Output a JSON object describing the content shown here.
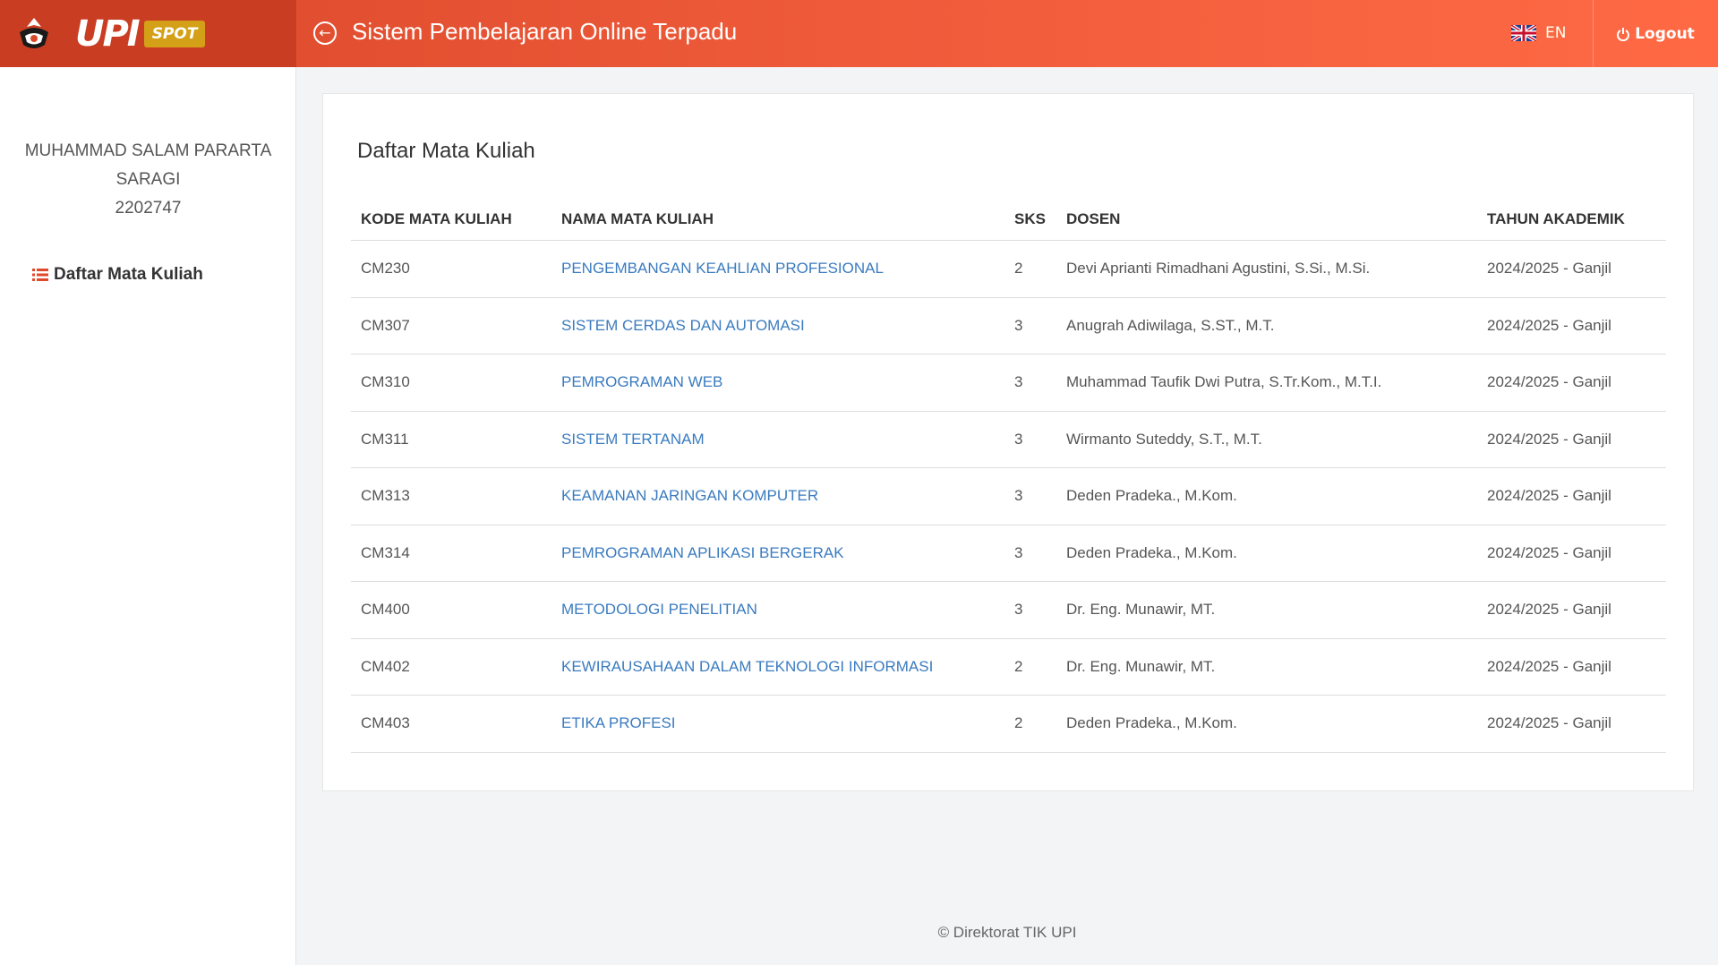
{
  "header": {
    "brand_text": "UPI",
    "brand_badge": "SPOT",
    "back_icon": "arrow-left-circle-icon",
    "title": "Sistem Pembelajaran Online Terpadu",
    "language_label": "EN",
    "logout_label": "Logout",
    "logout_icon": "power-icon",
    "colors": {
      "primary": "#ef5b3a",
      "brand_dark": "#c93e22",
      "badge": "#d4a017",
      "link": "#3a7bbf"
    }
  },
  "sidebar": {
    "user_name_line1": "MUHAMMAD SALAM PARARTA",
    "user_name_line2": "SARAGI",
    "user_id": "2202747",
    "nav_label": "Daftar Mata Kuliah",
    "nav_icon": "list-icon"
  },
  "main": {
    "title": "Daftar Mata Kuliah",
    "columns": [
      "KODE MATA KULIAH",
      "NAMA MATA KULIAH",
      "SKS",
      "DOSEN",
      "TAHUN AKADEMIK"
    ],
    "rows": [
      {
        "kode": "CM230",
        "nama": "PENGEMBANGAN KEAHLIAN PROFESIONAL",
        "sks": "2",
        "dosen": "Devi Aprianti Rimadhani Agustini, S.Si., M.Si.",
        "tahun": "2024/2025 - Ganjil"
      },
      {
        "kode": "CM307",
        "nama": "SISTEM CERDAS DAN AUTOMASI",
        "sks": "3",
        "dosen": "Anugrah Adiwilaga, S.ST., M.T.",
        "tahun": "2024/2025 - Ganjil"
      },
      {
        "kode": "CM310",
        "nama": "PEMROGRAMAN WEB",
        "sks": "3",
        "dosen": "Muhammad Taufik Dwi Putra, S.Tr.Kom., M.T.I.",
        "tahun": "2024/2025 - Ganjil"
      },
      {
        "kode": "CM311",
        "nama": "SISTEM TERTANAM",
        "sks": "3",
        "dosen": "Wirmanto Suteddy, S.T., M.T.",
        "tahun": "2024/2025 - Ganjil"
      },
      {
        "kode": "CM313",
        "nama": "KEAMANAN JARINGAN KOMPUTER",
        "sks": "3",
        "dosen": "Deden Pradeka., M.Kom.",
        "tahun": "2024/2025 - Ganjil"
      },
      {
        "kode": "CM314",
        "nama": "PEMROGRAMAN APLIKASI BERGERAK",
        "sks": "3",
        "dosen": "Deden Pradeka., M.Kom.",
        "tahun": "2024/2025 - Ganjil"
      },
      {
        "kode": "CM400",
        "nama": "METODOLOGI PENELITIAN",
        "sks": "3",
        "dosen": "Dr. Eng. Munawir, MT.",
        "tahun": "2024/2025 - Ganjil"
      },
      {
        "kode": "CM402",
        "nama": "KEWIRAUSAHAAN DALAM TEKNOLOGI INFORMASI",
        "sks": "2",
        "dosen": "Dr. Eng. Munawir, MT.",
        "tahun": "2024/2025 - Ganjil"
      },
      {
        "kode": "CM403",
        "nama": "ETIKA PROFESI",
        "sks": "2",
        "dosen": "Deden Pradeka., M.Kom.",
        "tahun": "2024/2025 - Ganjil"
      }
    ]
  },
  "footer": {
    "text": "© Direktorat TIK UPI"
  }
}
